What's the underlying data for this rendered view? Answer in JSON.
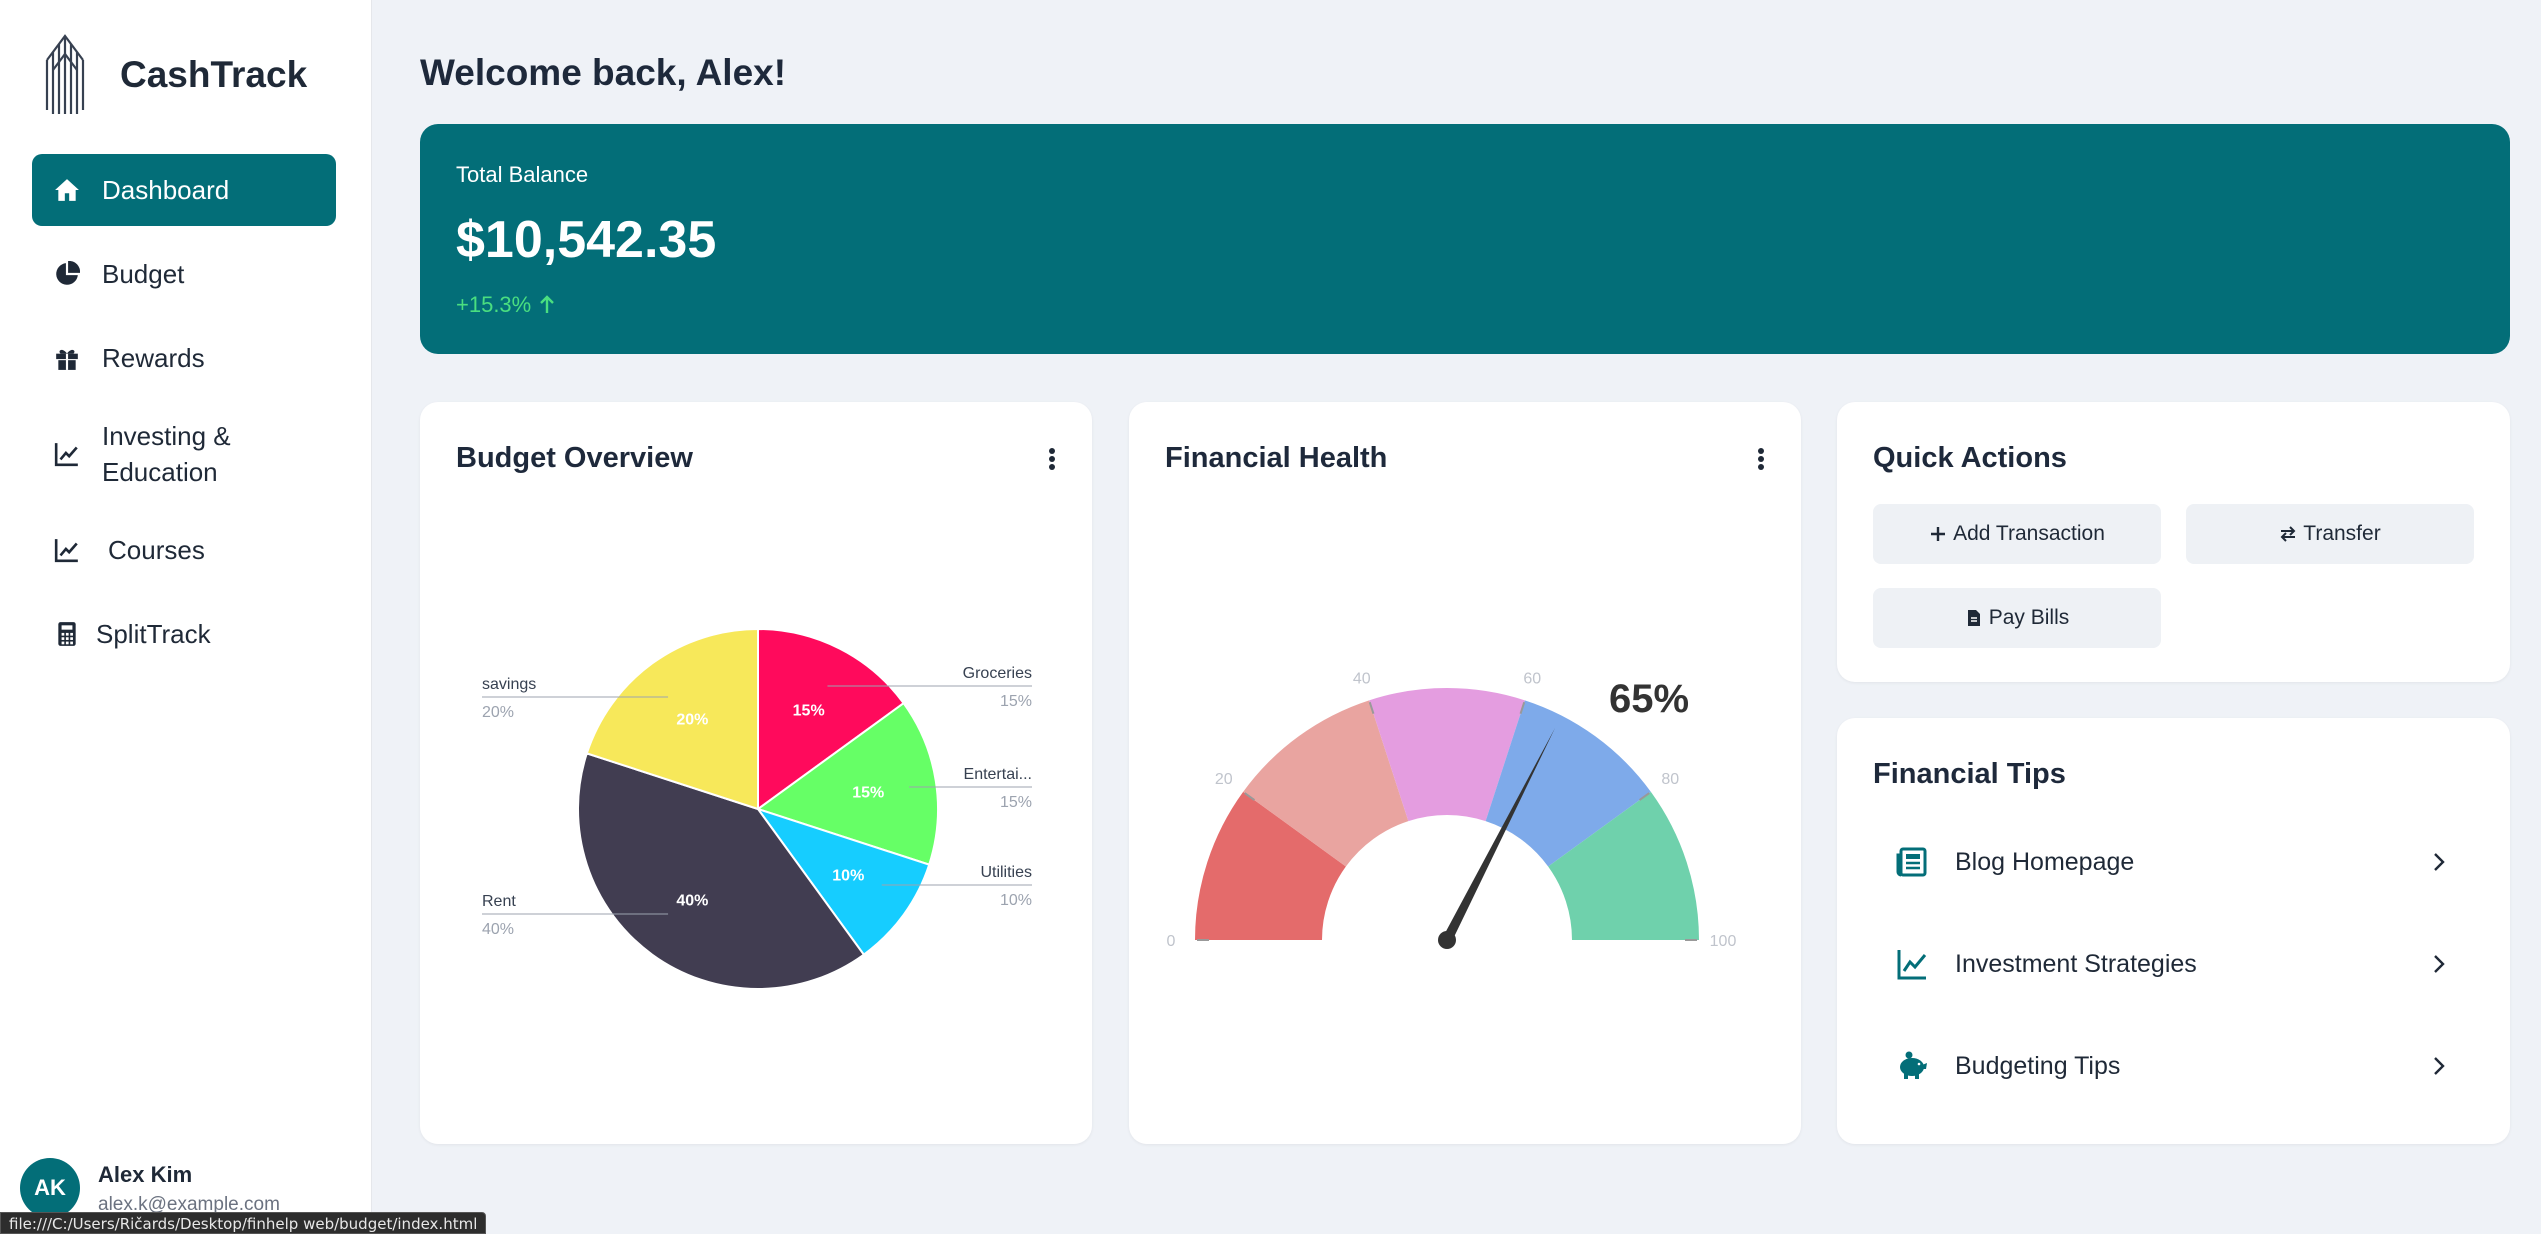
{
  "app": {
    "name": "CashTrack"
  },
  "sidebar": {
    "items": [
      {
        "label": "Dashboard",
        "icon": "home-icon"
      },
      {
        "label": "Budget",
        "icon": "pie-chart-icon"
      },
      {
        "label": "Rewards",
        "icon": "gift-icon"
      },
      {
        "label": "Investing & Education",
        "icon": "line-chart-icon"
      },
      {
        "label": "Courses",
        "icon": "line-chart-icon"
      },
      {
        "label": "SplitTrack",
        "icon": "calculator-icon"
      }
    ],
    "active": "Dashboard"
  },
  "user": {
    "initials": "AK",
    "name": "Alex Kim",
    "email": "alex.k@example.com"
  },
  "status_url": "file:///C:/Users/Ričards/Desktop/finhelp web/budget/index.html",
  "header": {
    "welcome": "Welcome back, Alex!"
  },
  "balance": {
    "label": "Total Balance",
    "amount": "$10,542.35",
    "change": "+15.3%"
  },
  "budget_overview": {
    "title": "Budget Overview"
  },
  "financial_health": {
    "title": "Financial Health",
    "score_label": "65%"
  },
  "quick_actions": {
    "title": "Quick Actions",
    "buttons": [
      {
        "label": "Add Transaction",
        "icon": "plus-icon"
      },
      {
        "label": "Transfer",
        "icon": "transfer-icon"
      },
      {
        "label": "Pay Bills",
        "icon": "document-icon"
      }
    ]
  },
  "financial_tips": {
    "title": "Financial Tips",
    "items": [
      {
        "label": "Blog Homepage",
        "icon": "newspaper-icon"
      },
      {
        "label": "Investment Strategies",
        "icon": "line-chart-icon"
      },
      {
        "label": "Budgeting Tips",
        "icon": "piggy-bank-icon"
      }
    ]
  },
  "colors": {
    "accent": "#036e78",
    "positive": "#4ade80"
  },
  "chart_data": [
    {
      "type": "pie",
      "categories": [
        "Groceries",
        "Entertai...",
        "Utilities",
        "Rent",
        "savings"
      ],
      "values": [
        15,
        15,
        10,
        40,
        20
      ],
      "slice_labels": [
        "15%",
        "15%",
        "10%",
        "40%",
        "20%"
      ],
      "legend_values": [
        "15%",
        "15%",
        "10%",
        "40%",
        "20%"
      ],
      "colors": [
        "#ff0a5c",
        "#66ff66",
        "#16cdff",
        "#413d51",
        "#f7e85a"
      ]
    },
    {
      "type": "gauge",
      "value": 65,
      "range": [
        0,
        100
      ],
      "ticks": [
        "0",
        "20",
        "40",
        "60",
        "80",
        "100"
      ],
      "bands": [
        {
          "from": 0,
          "to": 20,
          "color": "#e46b6b"
        },
        {
          "from": 20,
          "to": 40,
          "color": "#e9a4a0"
        },
        {
          "from": 40,
          "to": 60,
          "color": "#e49de0"
        },
        {
          "from": 60,
          "to": 80,
          "color": "#7eaaea"
        },
        {
          "from": 80,
          "to": 100,
          "color": "#6fd1ac"
        }
      ]
    }
  ]
}
